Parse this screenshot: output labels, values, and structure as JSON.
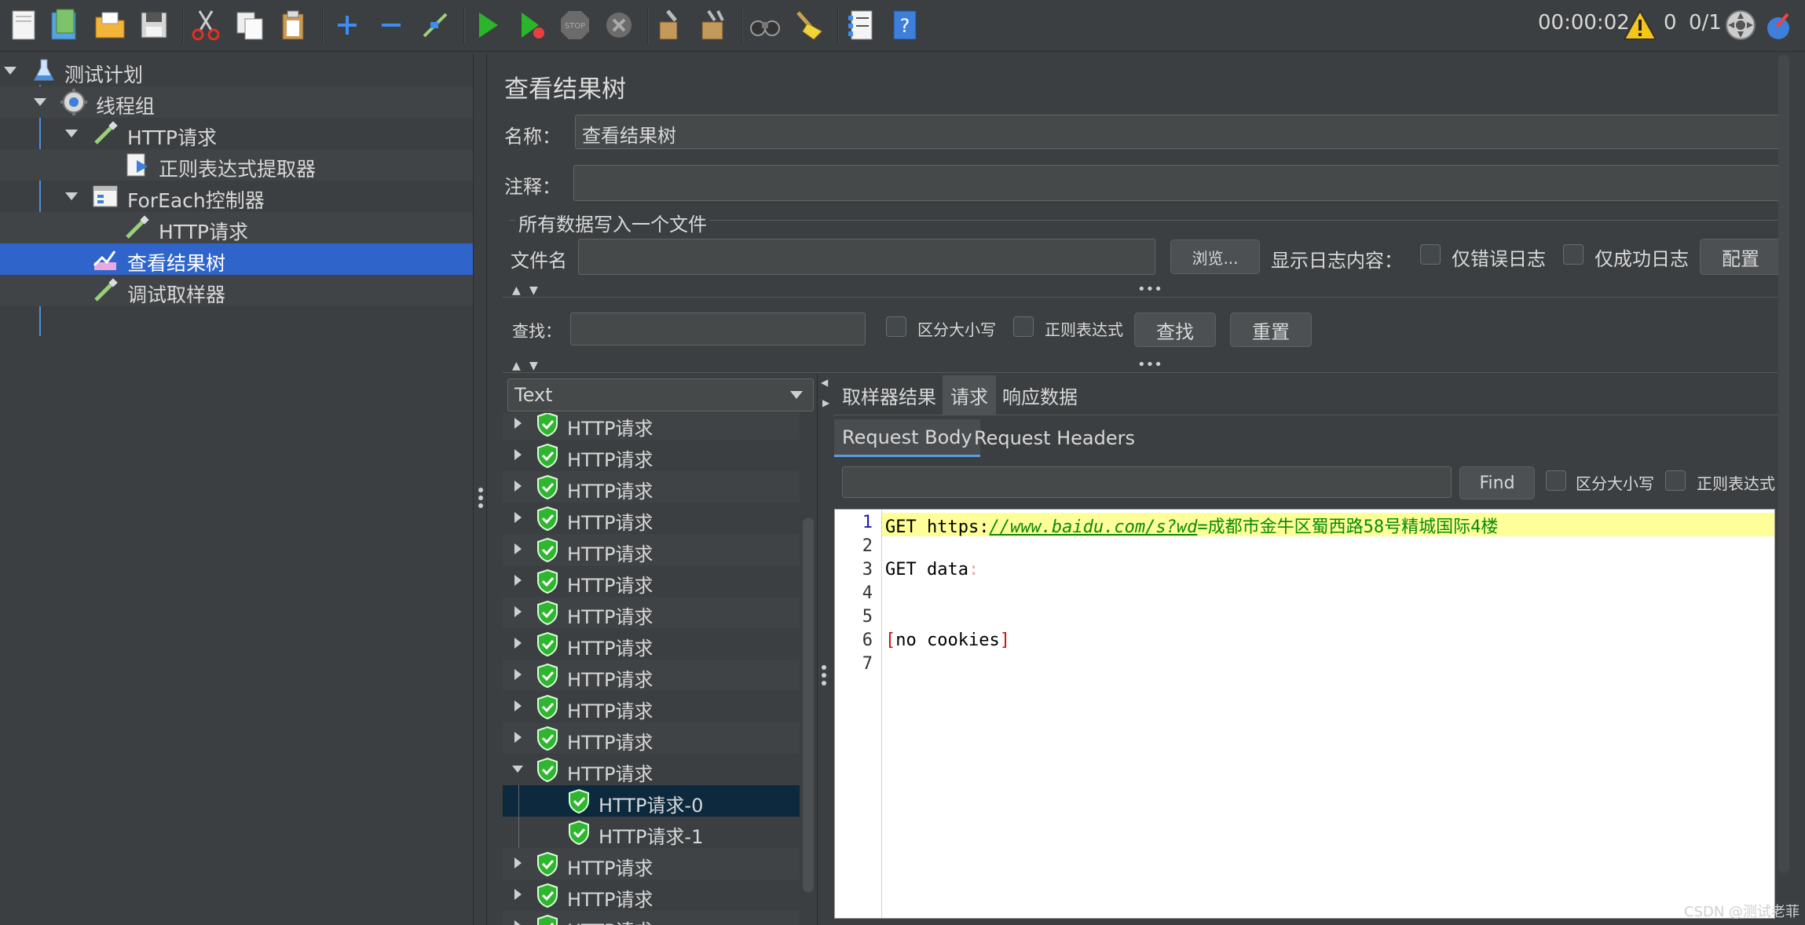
{
  "toolbar": {
    "icons": [
      "new-icon",
      "templates-icon",
      "open-icon",
      "save-icon",
      "cut-icon",
      "copy-icon",
      "paste-icon",
      "expand-icon",
      "collapse-icon",
      "toggle-icon",
      "start-icon",
      "start-no-pause-icon",
      "stop-icon",
      "shutdown-icon",
      "clear-icon",
      "clear-all-icon",
      "search-icon",
      "reset-search-icon",
      "function-helper-icon",
      "help-icon"
    ],
    "timer": "00:00:02",
    "warning_count": "0",
    "thread_count": "0/1"
  },
  "tree": {
    "items": [
      {
        "label": "测试计划"
      },
      {
        "label": "线程组"
      },
      {
        "label": "HTTP请求"
      },
      {
        "label": "正则表达式提取器"
      },
      {
        "label": "ForEach控制器"
      },
      {
        "label": "HTTP请求"
      },
      {
        "label": "查看结果树"
      },
      {
        "label": "调试取样器"
      }
    ]
  },
  "panel": {
    "title": "查看结果树",
    "name_label": "名称：",
    "name_value": "查看结果树",
    "comment_label": "注释：",
    "comment_value": "",
    "file_section_label": "所有数据写入一个文件",
    "filename_label": "文件名",
    "filename_value": "",
    "browse_button": "浏览...",
    "log_content_label": "显示日志内容：",
    "errors_only_label": "仅错误日志",
    "success_only_label": "仅成功日志",
    "configure_button": "配置"
  },
  "search": {
    "label": "查找：",
    "value": "",
    "case_sensitive_label": "区分大小写",
    "regex_label": "正则表达式",
    "find_button": "查找",
    "reset_button": "重置"
  },
  "renderer": {
    "selected": "Text"
  },
  "results": {
    "items": [
      {
        "label": "HTTP请求"
      },
      {
        "label": "HTTP请求"
      },
      {
        "label": "HTTP请求"
      },
      {
        "label": "HTTP请求"
      },
      {
        "label": "HTTP请求"
      },
      {
        "label": "HTTP请求"
      },
      {
        "label": "HTTP请求"
      },
      {
        "label": "HTTP请求"
      },
      {
        "label": "HTTP请求"
      },
      {
        "label": "HTTP请求"
      },
      {
        "label": "HTTP请求"
      },
      {
        "label": "HTTP请求"
      },
      {
        "label": "HTTP请求-0"
      },
      {
        "label": "HTTP请求-1"
      },
      {
        "label": "HTTP请求"
      },
      {
        "label": "HTTP请求"
      },
      {
        "label": "HTTP请求"
      }
    ]
  },
  "tabs": {
    "sampler_result": "取样器结果",
    "request": "请求",
    "response_data": "响应数据"
  },
  "subtabs": {
    "request_body": "Request Body",
    "request_headers": "Request Headers"
  },
  "body_search": {
    "value": "",
    "find_button": "Find",
    "case_sensitive_label": "区分大小写",
    "regex_label": "正则表达式"
  },
  "editor": {
    "line_numbers": [
      "1",
      "2",
      "3",
      "4",
      "5",
      "6",
      "7"
    ],
    "line1_method": "GET https:",
    "line1_url": "//www.baidu.com/s?wd",
    "line1_rest": "=成都市金牛区蜀西路58号精城国际4楼",
    "line3": "GET data",
    "line3_mark": ":",
    "line6_open": "[",
    "line6_text": "no cookies",
    "line6_close": "]"
  },
  "watermark": "CSDN @测试老菲"
}
